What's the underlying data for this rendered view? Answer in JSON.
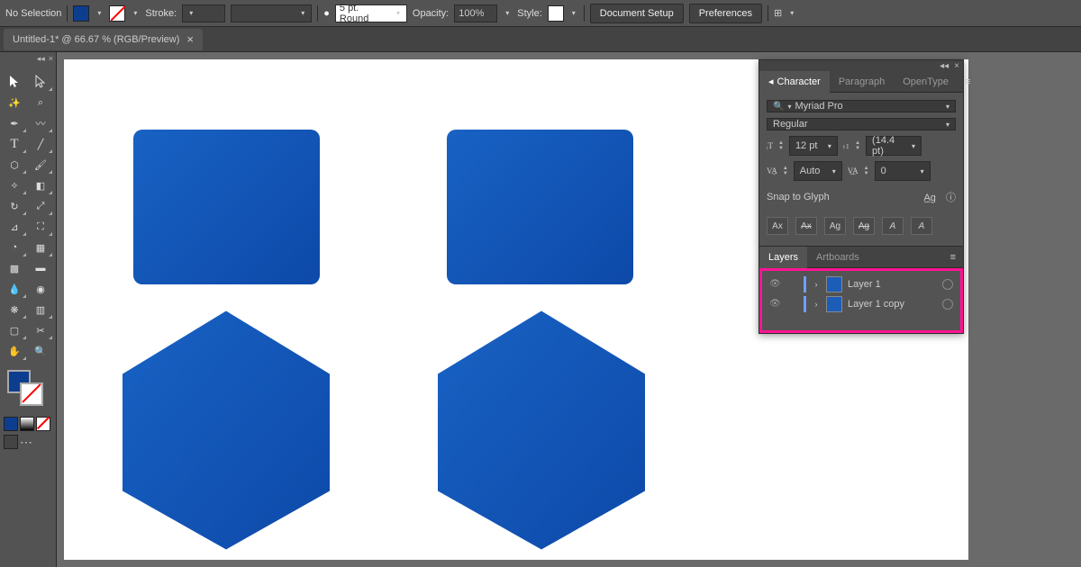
{
  "controlbar": {
    "selection": "No Selection",
    "stroke_label": "Stroke:",
    "stroke_weight": "5 pt. Round",
    "opacity_label": "Opacity:",
    "opacity_value": "100%",
    "style_label": "Style:",
    "doc_setup": "Document Setup",
    "preferences": "Preferences"
  },
  "tab": {
    "title": "Untitled-1* @ 66.67 % (RGB/Preview)"
  },
  "character": {
    "tabs": {
      "char": "Character",
      "para": "Paragraph",
      "ot": "OpenType"
    },
    "font": "Myriad Pro",
    "style": "Regular",
    "size": "12 pt",
    "leading": "(14.4 pt)",
    "kerning": "Auto",
    "tracking": "0",
    "snap": "Snap to Glyph",
    "snap_btns": {
      "ax": "Ax",
      "ax2": "Ax",
      "ag": "Ag",
      "ag2": "Ag",
      "a1": "A",
      "a2": "A"
    }
  },
  "layers": {
    "tabs": {
      "layers": "Layers",
      "artboards": "Artboards"
    },
    "rows": [
      {
        "name": "Layer 1"
      },
      {
        "name": "Layer 1 copy"
      }
    ]
  },
  "colors": {
    "shape_fill": "#0d49a8"
  }
}
